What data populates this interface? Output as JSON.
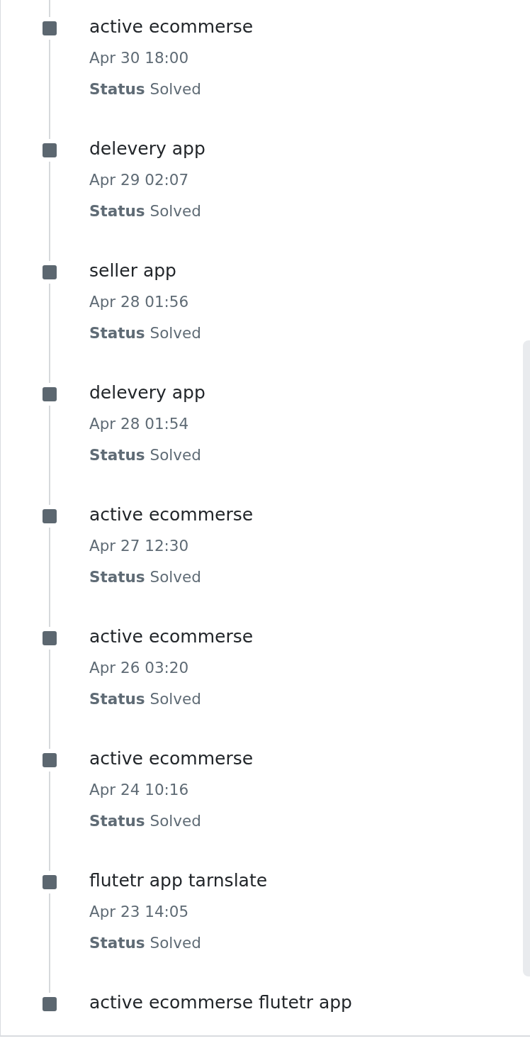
{
  "timeline": {
    "items": [
      {
        "title": "active ecommerse",
        "time": "Apr 30 18:00",
        "status": "**Status** Solved"
      },
      {
        "title": "delevery app",
        "time": "Apr 29 02:07",
        "status": "**Status** Solved"
      },
      {
        "title": "seller app",
        "time": "Apr 28 01:56",
        "status": "**Status** Solved"
      },
      {
        "title": "delevery app",
        "time": "Apr 28 01:54",
        "status": "**Status** Solved"
      },
      {
        "title": "active ecommerse",
        "time": "Apr 27 12:30",
        "status": "**Status** Solved"
      },
      {
        "title": "active ecommerse",
        "time": "Apr 26 03:20",
        "status": "**Status** Solved"
      },
      {
        "title": "active ecommerse",
        "time": "Apr 24 10:16",
        "status": "**Status** Solved"
      },
      {
        "title": "flutetr app tarnslate",
        "time": "Apr 23 14:05",
        "status": "**Status** Solved"
      },
      {
        "title": "active ecommerse flutetr app"
      }
    ]
  }
}
